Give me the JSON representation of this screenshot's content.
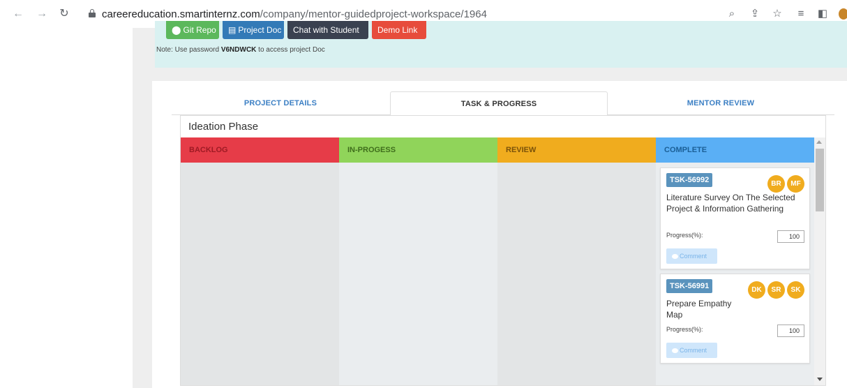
{
  "browser": {
    "url_domain": "careereducation.smartinternz.com",
    "url_path": "/company/mentor-guidedproject-workspace/1964"
  },
  "toolbar": {
    "buttons": [
      {
        "label": "Git Repo",
        "icon": "github-icon",
        "color": "#5cb85c"
      },
      {
        "label": "Project Doc",
        "icon": "document-icon",
        "color": "#337ab7"
      },
      {
        "label": "Chat with Student",
        "color": "#3a4150"
      },
      {
        "label": "Demo Link",
        "color": "#e74c3c"
      }
    ],
    "note_prefix": "Note: Use password ",
    "note_password": "V6NDWCK",
    "note_suffix": " to access project Doc"
  },
  "tabs": [
    {
      "label": "PROJECT DETAILS",
      "active": false
    },
    {
      "label": "TASK & PROGRESS",
      "active": true
    },
    {
      "label": "MENTOR REVIEW",
      "active": false
    }
  ],
  "phase": {
    "title": "Ideation Phase",
    "columns": [
      {
        "label": "BACKLOG",
        "color": "#e63c48"
      },
      {
        "label": "IN-PROGESS",
        "color": "#90d45a"
      },
      {
        "label": "REVIEW",
        "color": "#f0ac1e"
      },
      {
        "label": "COMPLETE",
        "color": "#5aaff5"
      }
    ],
    "cards": [
      {
        "id": "TSK-56992",
        "title": "Literature Survey On The Selected Project & Information Gathering",
        "assignees": [
          "BR",
          "MF"
        ],
        "progress_label": "Progress(%):",
        "progress_value": "100",
        "comment_label": "Comment"
      },
      {
        "id": "TSK-56991",
        "title": "Prepare Empathy Map",
        "assignees": [
          "DK",
          "SR",
          "SK"
        ],
        "progress_label": "Progress(%):",
        "progress_value": "100",
        "comment_label": "Comment"
      }
    ]
  }
}
